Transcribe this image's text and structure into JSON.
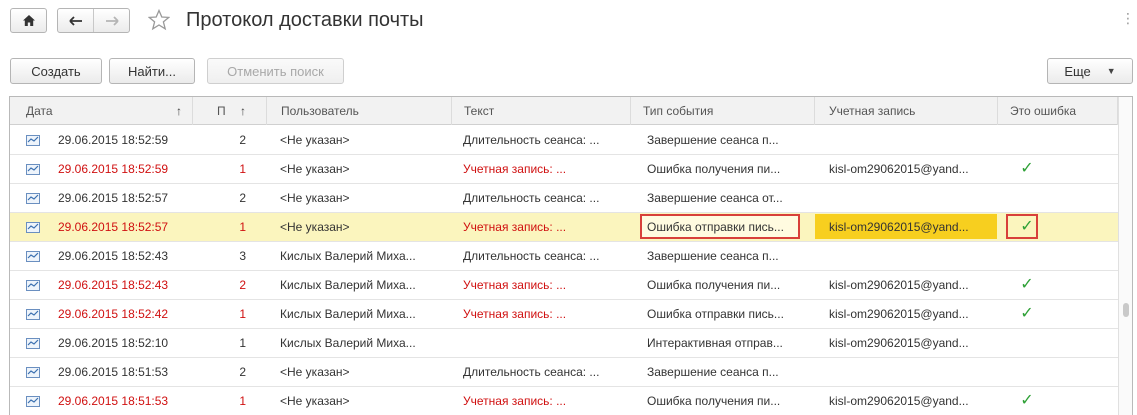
{
  "header": {
    "title": "Протокол доставки почты",
    "home_icon": "home-icon",
    "back_icon": "arrow-left-icon",
    "forward_icon": "arrow-right-icon",
    "favorite_icon": "star-icon",
    "more_icon": "more-vertical-icon"
  },
  "toolbar": {
    "create_label": "Создать",
    "find_label": "Найти...",
    "cancel_search_label": "Отменить поиск",
    "more_label": "Еще"
  },
  "table": {
    "columns": {
      "date": "Дата",
      "p": "П",
      "user": "Пользователь",
      "text": "Текст",
      "event_type": "Тип события",
      "account": "Учетная запись",
      "is_error": "Это ошибка"
    },
    "sort_indicator": "↑",
    "rows": [
      {
        "date": "29.06.2015 18:52:59",
        "p": "2",
        "user": "<Не указан>",
        "text": "Длительность сеанса: ...",
        "event_type": "Завершение сеанса п...",
        "account": "",
        "is_error": ""
      },
      {
        "date": "29.06.2015 18:52:59",
        "p": "1",
        "user": "<Не указан>",
        "text": "Учетная запись: ...",
        "event_type": "Ошибка получения пи...",
        "account": "kisl-om29062015@yand...",
        "is_error": "✓"
      },
      {
        "date": "29.06.2015 18:52:57",
        "p": "2",
        "user": "<Не указан>",
        "text": "Длительность сеанса: ...",
        "event_type": "Завершение сеанса от...",
        "account": "",
        "is_error": ""
      },
      {
        "date": "29.06.2015 18:52:57",
        "p": "1",
        "user": "<Не указан>",
        "text": "Учетная запись: ...",
        "event_type": "Ошибка отправки пись...",
        "account": "kisl-om29062015@yand...",
        "is_error": "✓"
      },
      {
        "date": "29.06.2015 18:52:43",
        "p": "3",
        "user": "Кислых Валерий Миха...",
        "text": "Длительность сеанса: ...",
        "event_type": "Завершение сеанса п...",
        "account": "",
        "is_error": ""
      },
      {
        "date": "29.06.2015 18:52:43",
        "p": "2",
        "user": "Кислых Валерий Миха...",
        "text": "Учетная запись: ...",
        "event_type": "Ошибка получения пи...",
        "account": "kisl-om29062015@yand...",
        "is_error": "✓"
      },
      {
        "date": "29.06.2015 18:52:42",
        "p": "1",
        "user": "Кислых Валерий Миха...",
        "text": "Учетная запись: ...",
        "event_type": "Ошибка отправки пись...",
        "account": "kisl-om29062015@yand...",
        "is_error": "✓"
      },
      {
        "date": "29.06.2015 18:52:10",
        "p": "1",
        "user": "Кислых Валерий Миха...",
        "text": "",
        "event_type": "Интерактивная отправ...",
        "account": "kisl-om29062015@yand...",
        "is_error": ""
      },
      {
        "date": "29.06.2015 18:51:53",
        "p": "2",
        "user": "<Не указан>",
        "text": "Длительность сеанса: ...",
        "event_type": "Завершение сеанса п...",
        "account": "",
        "is_error": ""
      },
      {
        "date": "29.06.2015 18:51:53",
        "p": "1",
        "user": "<Не указан>",
        "text": "Учетная запись: ...",
        "event_type": "Ошибка получения пи...",
        "account": "kisl-om29062015@yand...",
        "is_error": "✓"
      }
    ]
  },
  "colors": {
    "error_text": "#d01010",
    "selected_row": "#fbf5be",
    "highlight_border": "#d8403a",
    "highlight_account": "#f7cf1f",
    "check": "#2da035"
  }
}
